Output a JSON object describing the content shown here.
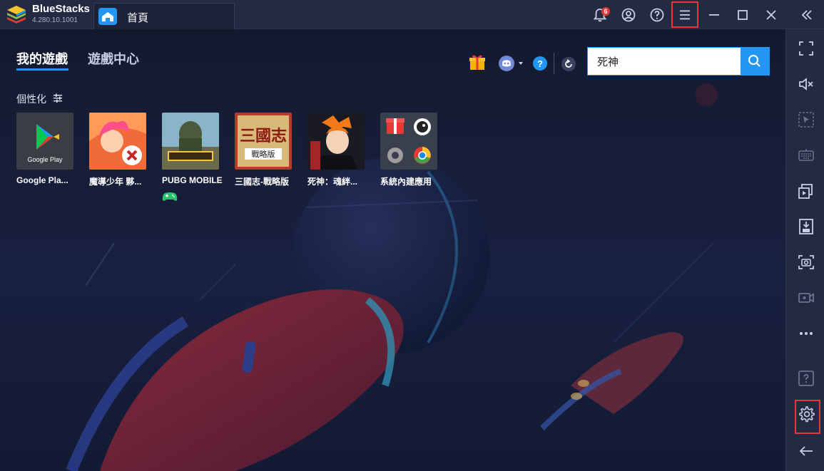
{
  "titlebar": {
    "brand_name": "BlueStacks",
    "version": "4.280.10.1001",
    "home_tab_label": "首頁",
    "notification_count": "6"
  },
  "main": {
    "tabs": [
      {
        "label": "我的遊戲",
        "active": true
      },
      {
        "label": "遊戲中心",
        "active": false
      }
    ],
    "search": {
      "value": "死神"
    },
    "section_label": "個性化"
  },
  "apps": [
    {
      "name": "Google Pla...",
      "icon": "google-play-icon"
    },
    {
      "name": "魔導少年 夥...",
      "icon": "fairy-tail-icon"
    },
    {
      "name": "PUBG MOBILE",
      "icon": "pubg-icon",
      "badge": "gamepad-icon"
    },
    {
      "name": "三國志-戰略版",
      "icon": "sanguozhi-icon",
      "icon_text_top": "三國志",
      "icon_text_bottom": "戰略版"
    },
    {
      "name": "死神：魂絆...",
      "icon": "bleach-icon"
    },
    {
      "name": "系統內建應用",
      "icon": "system-apps-icon"
    }
  ],
  "google_play_text": "Google Play",
  "colors": {
    "accent": "#2196f3",
    "highlight": "#e53935",
    "titlebar": "#232a42",
    "background": "#1a2138"
  }
}
